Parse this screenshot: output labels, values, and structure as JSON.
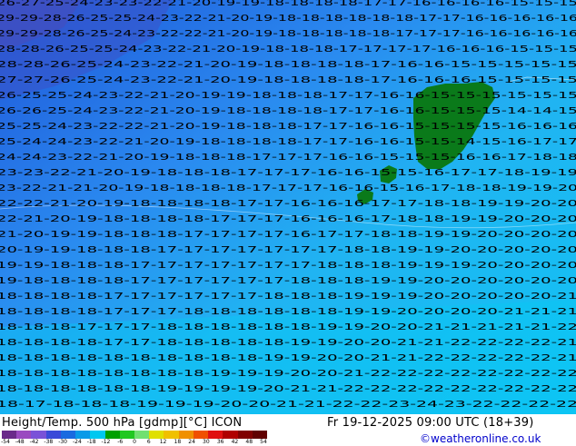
{
  "map": {
    "title": "Height/Temp. 500 hPa [gdmp][°C] ICON",
    "valid_time": "Fr 19-12-2025 09:00 UTC (18+39)",
    "credit": "©weatheronline.co.uk",
    "legend": {
      "ticks": [
        "-54",
        "-48",
        "-42",
        "-38",
        "-30",
        "-24",
        "-18",
        "-12",
        "-6",
        "0",
        "6",
        "12",
        "18",
        "24",
        "30",
        "36",
        "42",
        "48",
        "54"
      ],
      "colors": [
        "#6a2a8a",
        "#9a4ac0",
        "#7a52d8",
        "#3a4ad8",
        "#1a6ae0",
        "#0a9ae8",
        "#00c8f0",
        "#00a000",
        "#20c820",
        "#70e070",
        "#e0e000",
        "#f0c000",
        "#f09000",
        "#f05000",
        "#e01010",
        "#b00000",
        "#800000",
        "#600000"
      ]
    },
    "rows": [
      "26-27-25-24-23-23-22-21-20-19-19-18-18-18-18-17-17-16-16-16-16-15-15-15",
      "29-29-28-26-25-25-24-23-22-21-20-19-18-18-18-18-18-18-17-17-16-16-16-16-16",
      "29-29-28-26-25-24-23-22-22-21-20-19-18-18-18-18-18-17-17-17-16-16-16-16-16",
      "28-28-26-25-25-24-23-22-21-20-19-18-18-18-17-17-17-17-16-16-16-15-15-15",
      "28-28-26-25-24-23-22-21-20-19-18-18-18-18-17-16-16-15-15-15-15-15",
      "27-27-26-25-24-23-22-21-20-19-18-18-18-18-17-16-16-16-15-15-15-15",
      "26-25-25-24-23-22-21-20-19-19-18-18-18-17-17-16-16-15-15-15-15-15-15",
      "26-26-25-24-23-22-21-20-19-18-18-18-18-17-17-16-16-15-15-15-14-14-15",
      "25-25-24-23-22-22-21-20-19-18-18-18-17-17-16-16-15-15-15-15-16-16-16",
      "25-24-24-23-22-21-20-19-18-18-18-18-17-17-16-16-15-15-14-15-16-17-17",
      "24-24-23-22-21-20-19-18-18-18-17-17-17-16-16-15-15-15-16-16-17-18-18",
      "23-23-22-21-20-19-18-18-18-17-17-17-16-16-15-15-16-17-17-18-19-19",
      "23-22-21-21-20-19-18-18-18-18-17-17-17-16-16-15-16-17-18-18-19-19-20",
      "22-22-21-20-19-18-18-18-18-17-17-16-16-16-17-17-18-18-19-19-20-20",
      "22-21-20-19-18-18-18-18-17-17-17-16-16-16-17-18-18-19-19-20-20-20",
      "21-20-19-19-18-18-18-17-17-17-17-16-17-17-18-18-19-19-20-20-20-20",
      "20-19-19-18-18-18-17-17-17-17-17-17-17-18-18-19-19-20-20-20-20-20",
      "19-19-18-18-18-17-17-17-17-17-17-17-18-18-18-19-19-19-20-20-20-20",
      "19-18-18-18-18-17-17-17-17-17-17-18-18-18-19-19-20-20-20-20-20-20",
      "18-18-18-18-17-17-17-17-17-17-18-18-18-19-19-19-20-20-20-20-20-21",
      "18-18-18-18-17-17-17-18-18-18-18-18-18-19-19-20-20-20-20-21-21-21",
      "18-18-18-17-17-17-18-18-18-18-18-18-19-19-20-20-21-21-21-21-21-22",
      "18-18-18-18-17-17-18-18-18-18-18-19-19-20-20-21-21-22-22-22-22-21",
      "18-18-18-18-18-18-18-18-18-18-19-19-20-20-21-21-22-22-22-22-22-21",
      "18-18-18-18-18-18-18-18-19-19-19-20-20-21-22-22-22-22-22-22-22-22",
      "18-18-18-18-18-18-19-19-19-19-20-21-21-22-22-22-22-22-22-22-22-22",
      "18-17-18-18-18-19-19-19-20-20-21-21-22-22-23-24-23-22-22-22-22"
    ]
  }
}
